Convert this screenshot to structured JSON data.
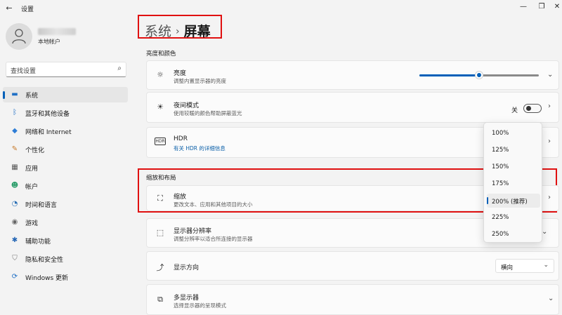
{
  "window": {
    "title": "设置",
    "back_icon": "back-arrow-icon"
  },
  "user": {
    "account_type": "本地帐户"
  },
  "search": {
    "placeholder": "查找设置"
  },
  "sidebar": {
    "items": [
      {
        "label": "系统",
        "icon": "system-icon",
        "active": true
      },
      {
        "label": "蓝牙和其他设备",
        "icon": "bluetooth-icon"
      },
      {
        "label": "网络和 Internet",
        "icon": "network-icon"
      },
      {
        "label": "个性化",
        "icon": "personalization-icon"
      },
      {
        "label": "应用",
        "icon": "apps-icon"
      },
      {
        "label": "帐户",
        "icon": "account-icon"
      },
      {
        "label": "时间和语言",
        "icon": "time-language-icon"
      },
      {
        "label": "游戏",
        "icon": "gaming-icon"
      },
      {
        "label": "辅助功能",
        "icon": "accessibility-icon"
      },
      {
        "label": "隐私和安全性",
        "icon": "privacy-icon"
      },
      {
        "label": "Windows 更新",
        "icon": "windows-update-icon"
      }
    ]
  },
  "breadcrumb": {
    "parent": "系统",
    "separator": "›",
    "current": "屏幕"
  },
  "sections": {
    "brightness_color": "亮度和颜色",
    "scale_layout": "缩放和布局"
  },
  "brightness": {
    "title": "亮度",
    "subtitle": "调整内置显示器的亮度",
    "level": 0.5
  },
  "night_light": {
    "title": "夜间模式",
    "subtitle": "使用较暖的颜色帮助屏蔽蓝光",
    "state_label": "关"
  },
  "hdr": {
    "title": "HDR",
    "link": "有关 HDR 的详细信息"
  },
  "scale": {
    "title": "缩放",
    "subtitle": "更改文本、应用和其他项目的大小"
  },
  "resolution": {
    "title": "显示器分辨率",
    "subtitle": "调整分辨率以适合所连接的显示器"
  },
  "orientation": {
    "title": "显示方向",
    "value": "横向"
  },
  "multi_display": {
    "title": "多显示器",
    "subtitle": "选择显示器的呈现模式"
  },
  "scale_popup": {
    "options": [
      "100%",
      "125%",
      "150%",
      "175%",
      "200% (推荐)",
      "225%",
      "250%"
    ],
    "selected_index": 4
  },
  "colors": {
    "accent": "#005fb8",
    "highlight": "#e01010"
  }
}
